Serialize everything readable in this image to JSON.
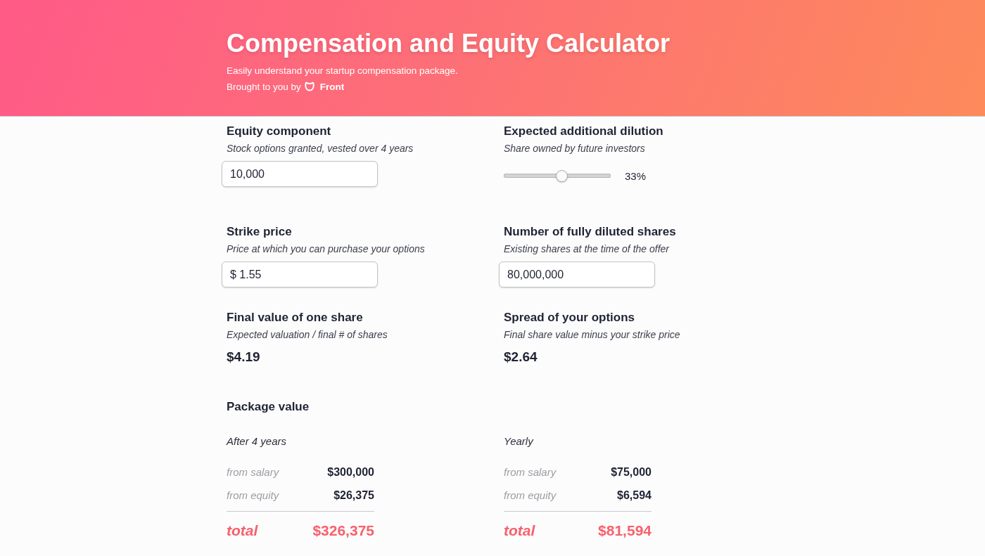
{
  "header": {
    "title": "Compensation and Equity Calculator",
    "subtitle": "Easily understand your startup compensation package.",
    "credit": {
      "text": "Brought to you by",
      "brand": "Front"
    }
  },
  "fields": [
    {
      "kind": "input",
      "title": "Equity component",
      "hint": "Stock options granted, vested over 4 years",
      "value": "10,000"
    },
    {
      "kind": "slider",
      "title": "Expected additional dilution",
      "hint": "Share owned by future investors",
      "level": 0.54,
      "reading": "33%"
    },
    {
      "kind": "input",
      "title": "Strike price",
      "hint": "Price at which you can purchase your options",
      "value": "$ 1.55"
    },
    {
      "kind": "input",
      "title": "Number of fully diluted shares",
      "hint": "Existing shares at the time of the offer",
      "value": "80,000,000"
    },
    {
      "kind": "result",
      "title": "Final value of one share",
      "hint": "Expected valuation / final # of shares",
      "value": "$4.19"
    },
    {
      "kind": "result",
      "title": "Spread of your options",
      "hint": "Final share value minus your strike price",
      "value": "$2.64"
    }
  ],
  "package": {
    "title": "Package value",
    "columns": [
      {
        "period": "After 4 years",
        "rows": [
          {
            "label": "from salary",
            "value": "$300,000"
          },
          {
            "label": "from equity",
            "value": "$26,375"
          }
        ],
        "total": {
          "label": "total",
          "value": "$326,375"
        }
      },
      {
        "period": "Yearly",
        "rows": [
          {
            "label": "from salary",
            "value": "$75,000"
          },
          {
            "label": "from equity",
            "value": "$6,594"
          }
        ],
        "total": {
          "label": "total",
          "value": "$81,594"
        }
      }
    ]
  }
}
